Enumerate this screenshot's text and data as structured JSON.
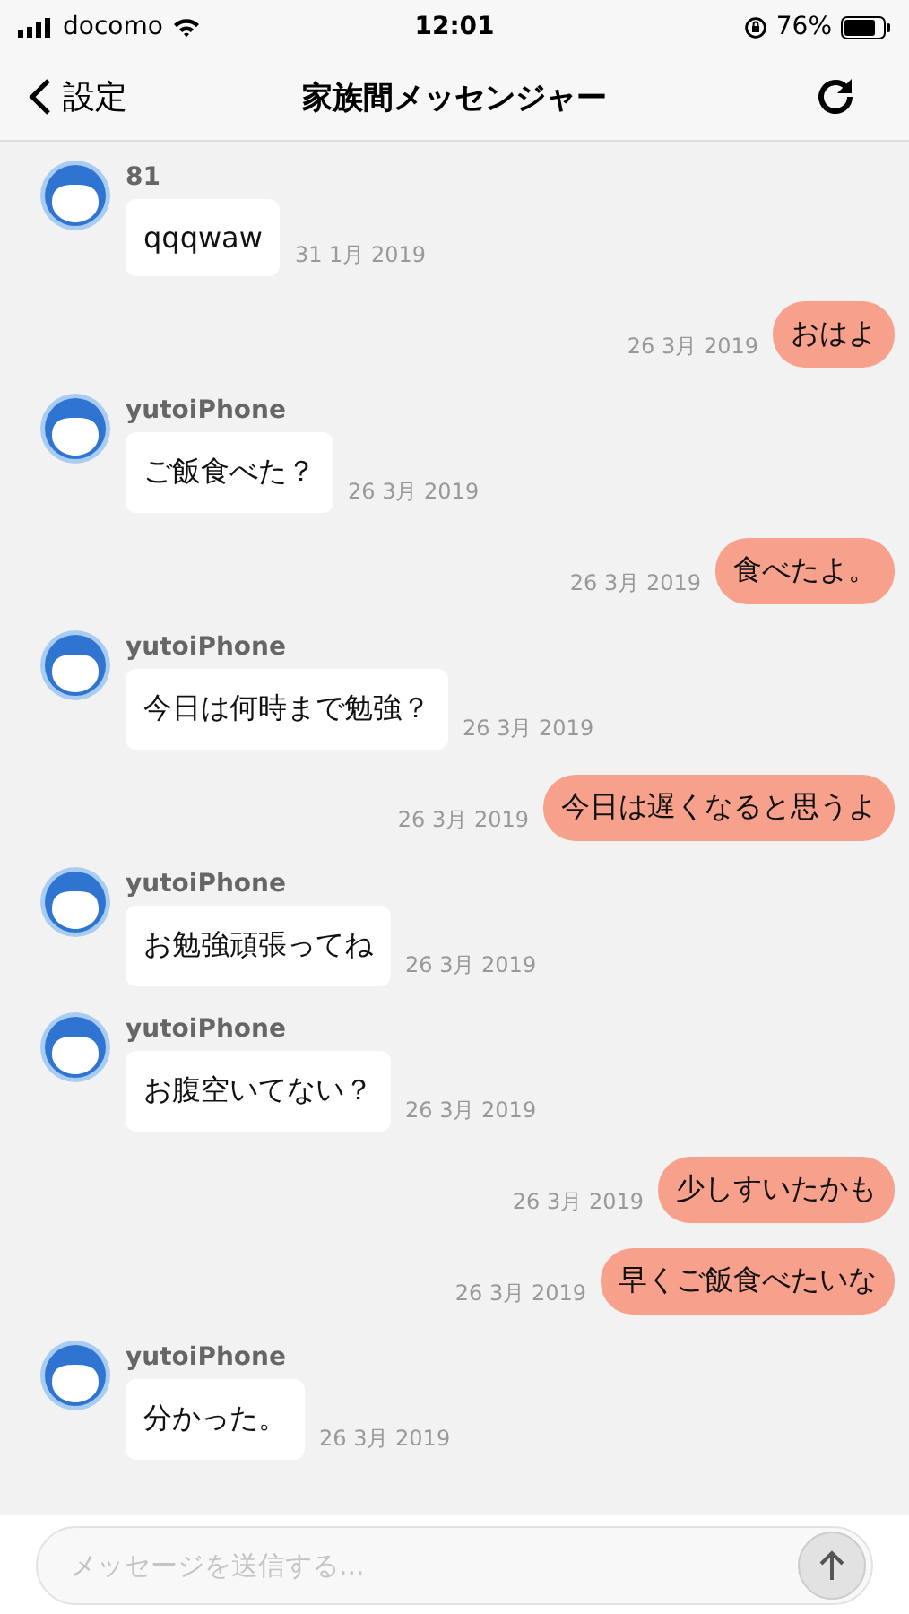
{
  "status_bar": {
    "carrier": "docomo",
    "time": "12:01",
    "battery": "76%"
  },
  "nav": {
    "back": "設定",
    "title": "家族間メッセンジャー"
  },
  "messages": [
    {
      "kind": "incoming",
      "sender": "81",
      "text": "qqqwaw",
      "date": "31 1月 2019"
    },
    {
      "kind": "outgoing",
      "text": "おはよ",
      "date": "26 3月 2019"
    },
    {
      "kind": "incoming",
      "sender": "yutoiPhone",
      "text": "ご飯食べた？",
      "date": "26 3月 2019"
    },
    {
      "kind": "outgoing",
      "text": "食べたよ。",
      "date": "26 3月 2019"
    },
    {
      "kind": "incoming",
      "sender": "yutoiPhone",
      "text": "今日は何時まで勉強？",
      "date": "26 3月 2019"
    },
    {
      "kind": "outgoing",
      "text": "今日は遅くなると思うよ",
      "date": "26 3月 2019"
    },
    {
      "kind": "incoming",
      "sender": "yutoiPhone",
      "text": "お勉強頑張ってね",
      "date": "26 3月 2019"
    },
    {
      "kind": "incoming",
      "sender": "yutoiPhone",
      "text": "お腹空いてない？",
      "date": "26 3月 2019"
    },
    {
      "kind": "outgoing",
      "text": "少しすいたかも",
      "date": "26 3月 2019"
    },
    {
      "kind": "outgoing",
      "text": "早くご飯食べたいな",
      "date": "26 3月 2019"
    },
    {
      "kind": "incoming",
      "sender": "yutoiPhone",
      "text": "分かった。",
      "date": "26 3月 2019"
    }
  ],
  "composer": {
    "placeholder": "メッセージを送信する..."
  }
}
